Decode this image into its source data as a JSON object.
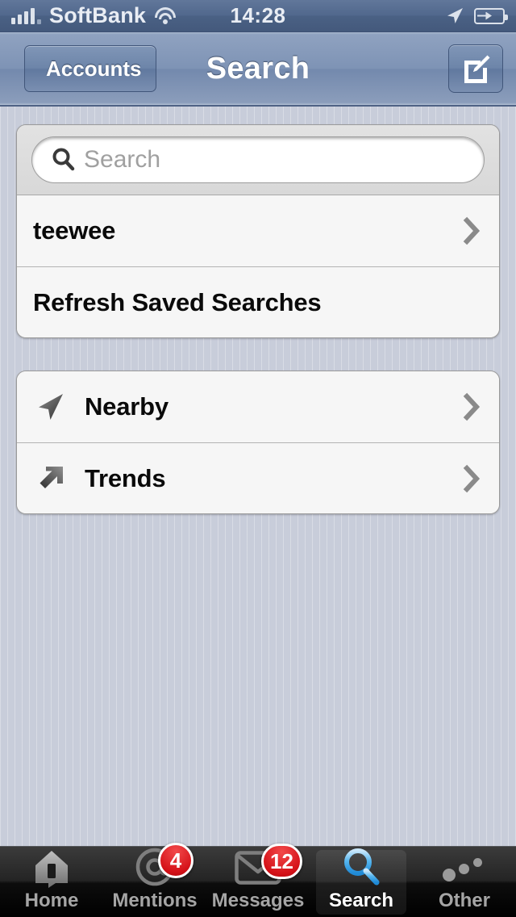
{
  "status_bar": {
    "carrier": "SoftBank",
    "time": "14:28",
    "signal_icon": "signal-bars-icon",
    "wifi_icon": "wifi-icon",
    "location_icon": "location-arrow-icon",
    "battery_icon": "battery-charging-icon"
  },
  "nav_bar": {
    "back_label": "Accounts",
    "title": "Search",
    "compose_icon": "compose-icon"
  },
  "search": {
    "placeholder": "Search",
    "value": "",
    "icon": "search-icon"
  },
  "saved_searches": [
    {
      "label": "teewee",
      "icon": null,
      "chevron": true
    },
    {
      "label": "Refresh Saved Searches",
      "icon": null,
      "chevron": false
    }
  ],
  "discover": [
    {
      "label": "Nearby",
      "icon": "location-arrow-icon",
      "chevron": true
    },
    {
      "label": "Trends",
      "icon": "arrow-up-right-icon",
      "chevron": true
    }
  ],
  "tab_bar": {
    "items": [
      {
        "label": "Home",
        "icon": "home-icon",
        "badge": null,
        "active": false
      },
      {
        "label": "Mentions",
        "icon": "at-icon",
        "badge": "4",
        "active": false
      },
      {
        "label": "Messages",
        "icon": "envelope-icon",
        "badge": "12",
        "active": false
      },
      {
        "label": "Search",
        "icon": "search-icon",
        "badge": null,
        "active": true
      },
      {
        "label": "Other",
        "icon": "more-dots-icon",
        "badge": null,
        "active": false
      }
    ]
  },
  "colors": {
    "background": "#c8cdda",
    "nav_blue": "#7389ad",
    "badge_red": "#d51219",
    "active_tab_accent": "#4db2ef",
    "row_bg": "#f6f6f6"
  }
}
